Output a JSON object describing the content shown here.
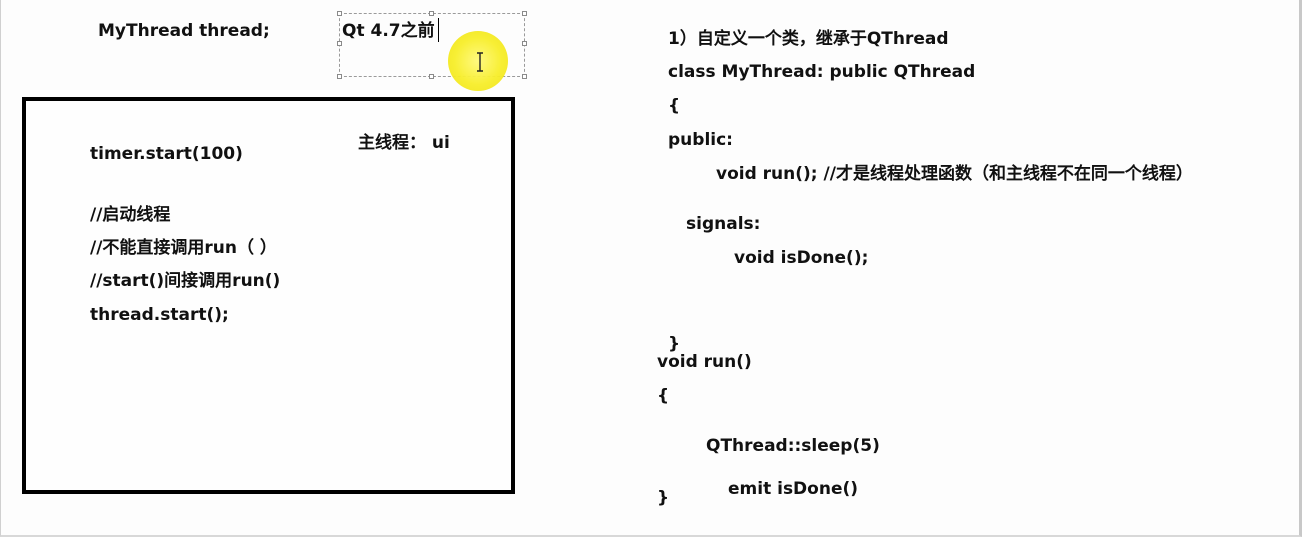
{
  "header": {
    "declaration": "MyThread thread;"
  },
  "edit_box": {
    "text": "Qt 4.7之前"
  },
  "left_panel": {
    "main_thread_label": "主线程： ui",
    "timer_line": "timer.start(100)",
    "comment_start": "//启动线程",
    "comment_no_direct": "//不能直接调用run（ ）",
    "comment_indirect": "//start()间接调用run()",
    "thread_start": "thread.start();"
  },
  "right_panel": {
    "step_title": "1）自定义一个类，继承于QThread",
    "class_decl": "class MyThread: public QThread",
    "open_brace": "{",
    "public_label": "public:",
    "run_decl": "void run(); //才是线程处理函数（和主线程不在同一个线程）",
    "signals_label": "signals:",
    "isdone_decl": "void isDone();",
    "close_brace": "}",
    "run_def": "void run()",
    "run_open_brace": "{",
    "sleep_call": "QThread::sleep(5)",
    "emit_call": "emit isDone()",
    "run_close_brace": "}"
  },
  "colors": {
    "cursor_highlight": "#f7ee2a",
    "frame_border": "#000000"
  },
  "icons": {
    "cursor": "text-ibeam-cursor-icon"
  }
}
